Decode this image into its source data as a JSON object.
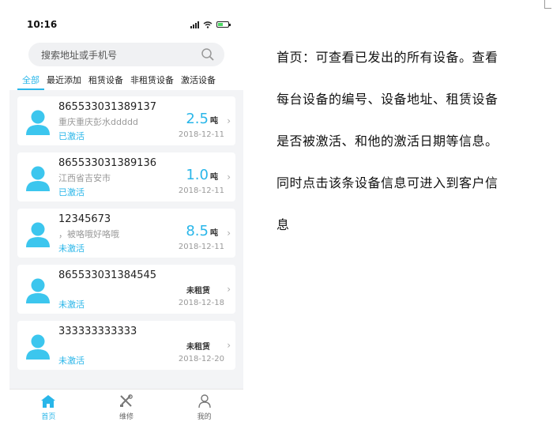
{
  "status": {
    "time": "10:16"
  },
  "search": {
    "placeholder": "搜索地址或手机号"
  },
  "tabs": [
    {
      "label": "全部",
      "active": true
    },
    {
      "label": "最近添加"
    },
    {
      "label": "租赁设备"
    },
    {
      "label": "非租赁设备"
    },
    {
      "label": "激活设备"
    }
  ],
  "devices": [
    {
      "id": "865533031389137",
      "address": "重庆重庆彭水ddddd",
      "status": "已激活",
      "tons": "2.5",
      "unit": "吨",
      "date": "2018-12-11"
    },
    {
      "id": "865533031389136",
      "address": "江西省吉安市",
      "status": "已激活",
      "tons": "1.0",
      "unit": "吨",
      "date": "2018-12-11"
    },
    {
      "id": "12345673",
      "address": "，被咯哦好咯哦",
      "status": "未激活",
      "tons": "8.5",
      "unit": "吨",
      "date": "2018-12-11"
    },
    {
      "id": "865533031384545",
      "address": "",
      "status": "未激活",
      "rent": "未租赁",
      "date": "2018-12-18"
    },
    {
      "id": "333333333333",
      "address": "",
      "status": "未激活",
      "rent": "未租赁",
      "date": "2018-12-20"
    }
  ],
  "nav": [
    {
      "label": "首页",
      "icon": "home-icon",
      "active": true
    },
    {
      "label": "维修",
      "icon": "tools-icon"
    },
    {
      "label": "我的",
      "icon": "user-icon"
    }
  ],
  "description": {
    "line1": "首页：可查看已发出的所有设备。查看",
    "line2": "每台设备的编号、设备地址、租赁设备",
    "line3": "是否被激活、和他的激活日期等信息。",
    "line4": "同时点击该条设备信息可进入到客户信",
    "line5": "息"
  },
  "colors": {
    "accent": "#29b6e9",
    "background": "#f3f4f6"
  }
}
